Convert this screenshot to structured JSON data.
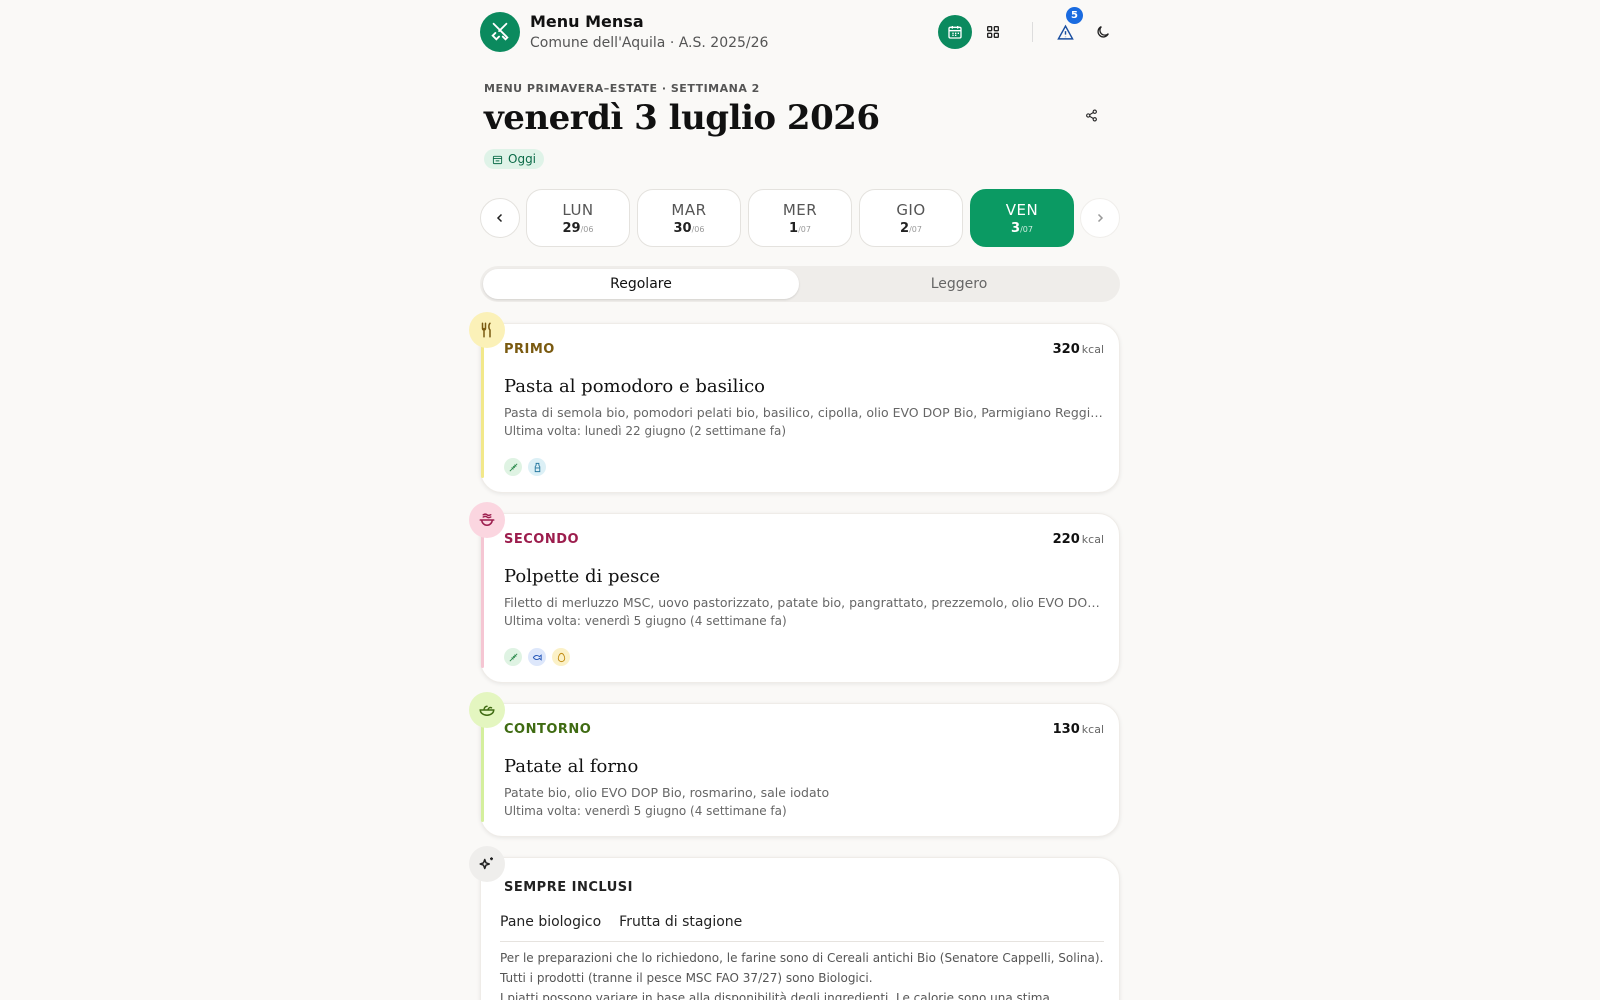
{
  "app": {
    "title": "Menu Mensa",
    "subtitle": "Comune dell'Aquila · A.S. 2025/26",
    "logo_icon": "fork-knife-icon",
    "alerts_count": "5",
    "accent": "#0b8a5e"
  },
  "header": {
    "eyebrow": "MENU PRIMAVERA–ESTATE · SETTIMANA 2",
    "date": "venerdì 3 luglio 2026",
    "today": "Oggi"
  },
  "days": [
    {
      "name": "LUN",
      "num": "29",
      "month": "/06",
      "selected": false
    },
    {
      "name": "MAR",
      "num": "30",
      "month": "/06",
      "selected": false
    },
    {
      "name": "MER",
      "num": "1",
      "month": "/07",
      "selected": false
    },
    {
      "name": "GIO",
      "num": "2",
      "month": "/07",
      "selected": false
    },
    {
      "name": "VEN",
      "num": "3",
      "month": "/07",
      "selected": true
    }
  ],
  "menu_type": {
    "options": [
      "Regolare",
      "Leggero"
    ],
    "selected": "Regolare"
  },
  "courses": [
    {
      "label": "PRIMO",
      "kcal": "320",
      "kcal_unit": "kcal",
      "dish": "Pasta al pomodoro e basilico",
      "ingredients": "Pasta di semola bio, pomodori pelati bio, basilico, cipolla, olio EVO DOP Bio, Parmigiano Reggiano DOP",
      "last": "Ultima volta: lunedì 22 giugno (2 settimane fa)",
      "icon": "fork-knife-icon",
      "tags": [
        "gluten-icon",
        "milk-icon"
      ],
      "color": "#7a5a10"
    },
    {
      "label": "SECONDO",
      "kcal": "220",
      "kcal_unit": "kcal",
      "dish": "Polpette di pesce",
      "ingredients": "Filetto di merluzzo MSC, uovo pastorizzato, patate bio, pangrattato, prezzemolo, olio EVO DOP Bio",
      "last": "Ultima volta: venerdì 5 giugno (4 settimane fa)",
      "icon": "fish-dish-icon",
      "tags": [
        "gluten-icon",
        "fish-icon",
        "egg-icon"
      ],
      "color": "#9c1d4d"
    },
    {
      "label": "CONTORNO",
      "kcal": "130",
      "kcal_unit": "kcal",
      "dish": "Patate al forno",
      "ingredients": "Patate bio, olio EVO DOP Bio, rosmarino, sale iodato",
      "last": "Ultima volta: venerdì 5 giugno (4 settimane fa)",
      "icon": "salad-icon",
      "tags": [],
      "color": "#3f6b12"
    }
  ],
  "always_included": {
    "title": "SEMPRE INCLUSI",
    "items": [
      "Pane biologico",
      "Frutta di stagione"
    ],
    "notes": [
      "Per le preparazioni che lo richiedono, le farine sono di Cereali antichi Bio (Senatore Cappelli, Solina).",
      "Tutti i prodotti (tranne il pesce MSC FAO 37/27) sono Biologici.",
      "I piatti possono variare in base alla disponibilità degli ingredienti. Le calorie sono una stima."
    ]
  }
}
